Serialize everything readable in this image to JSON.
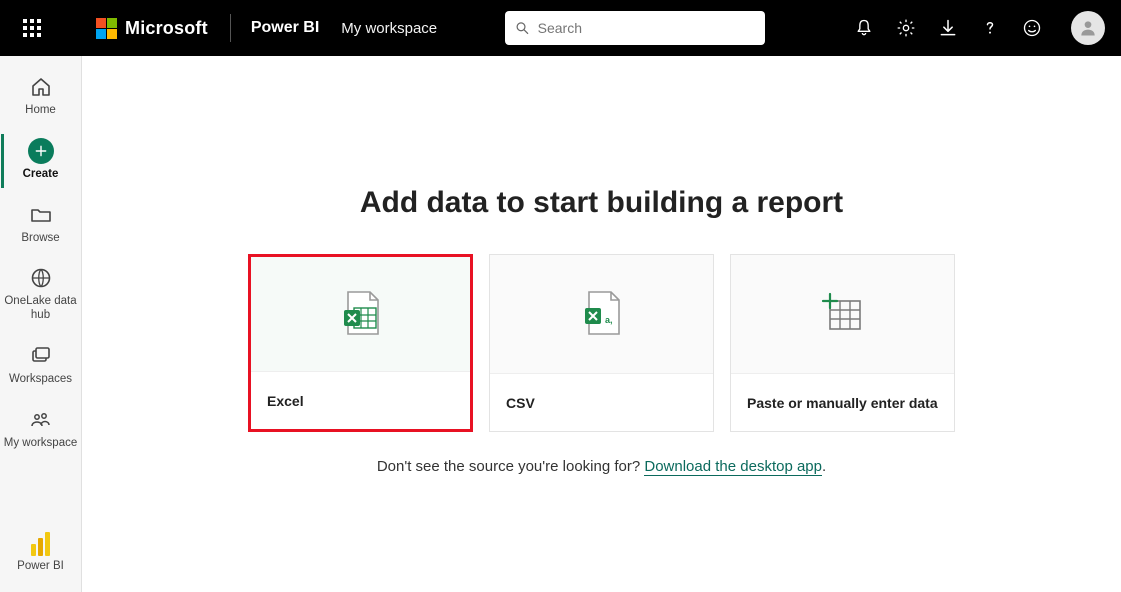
{
  "header": {
    "brand": "Microsoft",
    "app": "Power BI",
    "workspace": "My workspace",
    "search_placeholder": "Search"
  },
  "sidebar": {
    "items": [
      {
        "label": "Home"
      },
      {
        "label": "Create"
      },
      {
        "label": "Browse"
      },
      {
        "label": "OneLake data hub"
      },
      {
        "label": "Workspaces"
      },
      {
        "label": "My workspace"
      }
    ],
    "footer_label": "Power BI"
  },
  "main": {
    "heading": "Add data to start building a report",
    "cards": [
      {
        "label": "Excel"
      },
      {
        "label": "CSV"
      },
      {
        "label": "Paste or manually enter data"
      }
    ],
    "hint_prefix": "Don't see the source you're looking for? ",
    "hint_link": "Download the desktop app",
    "hint_suffix": "."
  }
}
